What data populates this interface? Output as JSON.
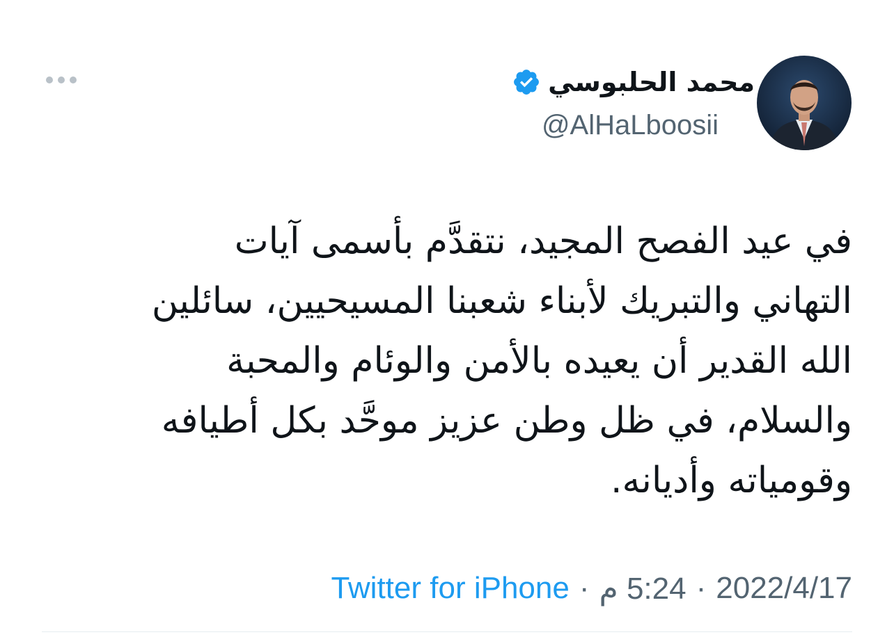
{
  "author": {
    "display_name": "محمد الحلبوسي",
    "handle": "@AlHaLboosii",
    "verified": true
  },
  "tweet": {
    "lines": [
      "في عيد الفصح المجيد، نتقدَّم بأسمى آيات",
      "التهاني والتبريك لأبناء شعبنا المسيحيين، سائلين",
      "الله القدير أن يعيده بالأمن والوئام والمحبة",
      "والسلام، في ظل وطن عزيز موحَّد بكل أطيافه",
      "وقومياته وأديانه."
    ]
  },
  "meta": {
    "date": "2022/4/17",
    "time": "5:24 م",
    "separator": "·",
    "source": "Twitter for iPhone"
  },
  "icons": {
    "verified": "verified-badge-icon",
    "more": "more-options-icon"
  },
  "colors": {
    "text": "#0f1419",
    "secondary": "#536471",
    "link": "#1d9bf0",
    "verified": "#1d9bf0"
  }
}
